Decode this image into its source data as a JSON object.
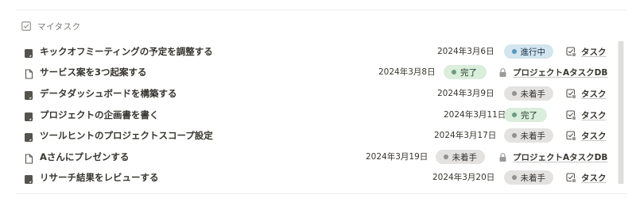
{
  "section": {
    "title": "マイタスク",
    "icon": "checkbox-icon"
  },
  "tasks": [
    {
      "title": "キックオフミーティングの予定を調整する",
      "icon": "task-page-icon",
      "date": "2024年3月6日",
      "status": "進行中",
      "status_type": "progress",
      "db_icon": "checkbox-icon",
      "db": "タスク"
    },
    {
      "title": "サービス案を3つ起案する",
      "icon": "document-icon",
      "date": "2024年3月8日",
      "status": "完了",
      "status_type": "done",
      "db_icon": "lock-icon",
      "db": "プロジェクトAタスクDB"
    },
    {
      "title": "データダッシュボードを構築する",
      "icon": "task-page-icon",
      "date": "2024年3月9日",
      "status": "未着手",
      "status_type": "todo",
      "db_icon": "checkbox-icon",
      "db": "タスク"
    },
    {
      "title": "プロジェクトの企画書を書く",
      "icon": "task-page-icon",
      "date": "2024年3月11日",
      "status": "完了",
      "status_type": "done",
      "db_icon": "checkbox-icon",
      "db": "タスク"
    },
    {
      "title": "ツールヒントのプロジェクトスコープ設定",
      "icon": "task-page-icon",
      "date": "2024年3月17日",
      "status": "未着手",
      "status_type": "todo",
      "db_icon": "checkbox-icon",
      "db": "タスク"
    },
    {
      "title": "Aさんにプレゼンする",
      "icon": "document-icon",
      "date": "2024年3月19日",
      "status": "未着手",
      "status_type": "todo",
      "db_icon": "lock-icon",
      "db": "プロジェクトAタスクDB"
    },
    {
      "title": "リサーチ結果をレビューする",
      "icon": "task-page-icon",
      "date": "2024年3月20日",
      "status": "未着手",
      "status_type": "todo",
      "db_icon": "checkbox-icon",
      "db": "タスク"
    }
  ],
  "colors": {
    "status_progress_bg": "#d3e5ef",
    "status_done_bg": "#dbeddb",
    "status_todo_bg": "#e3e2e0",
    "text": "#37352f",
    "muted": "#787774"
  }
}
